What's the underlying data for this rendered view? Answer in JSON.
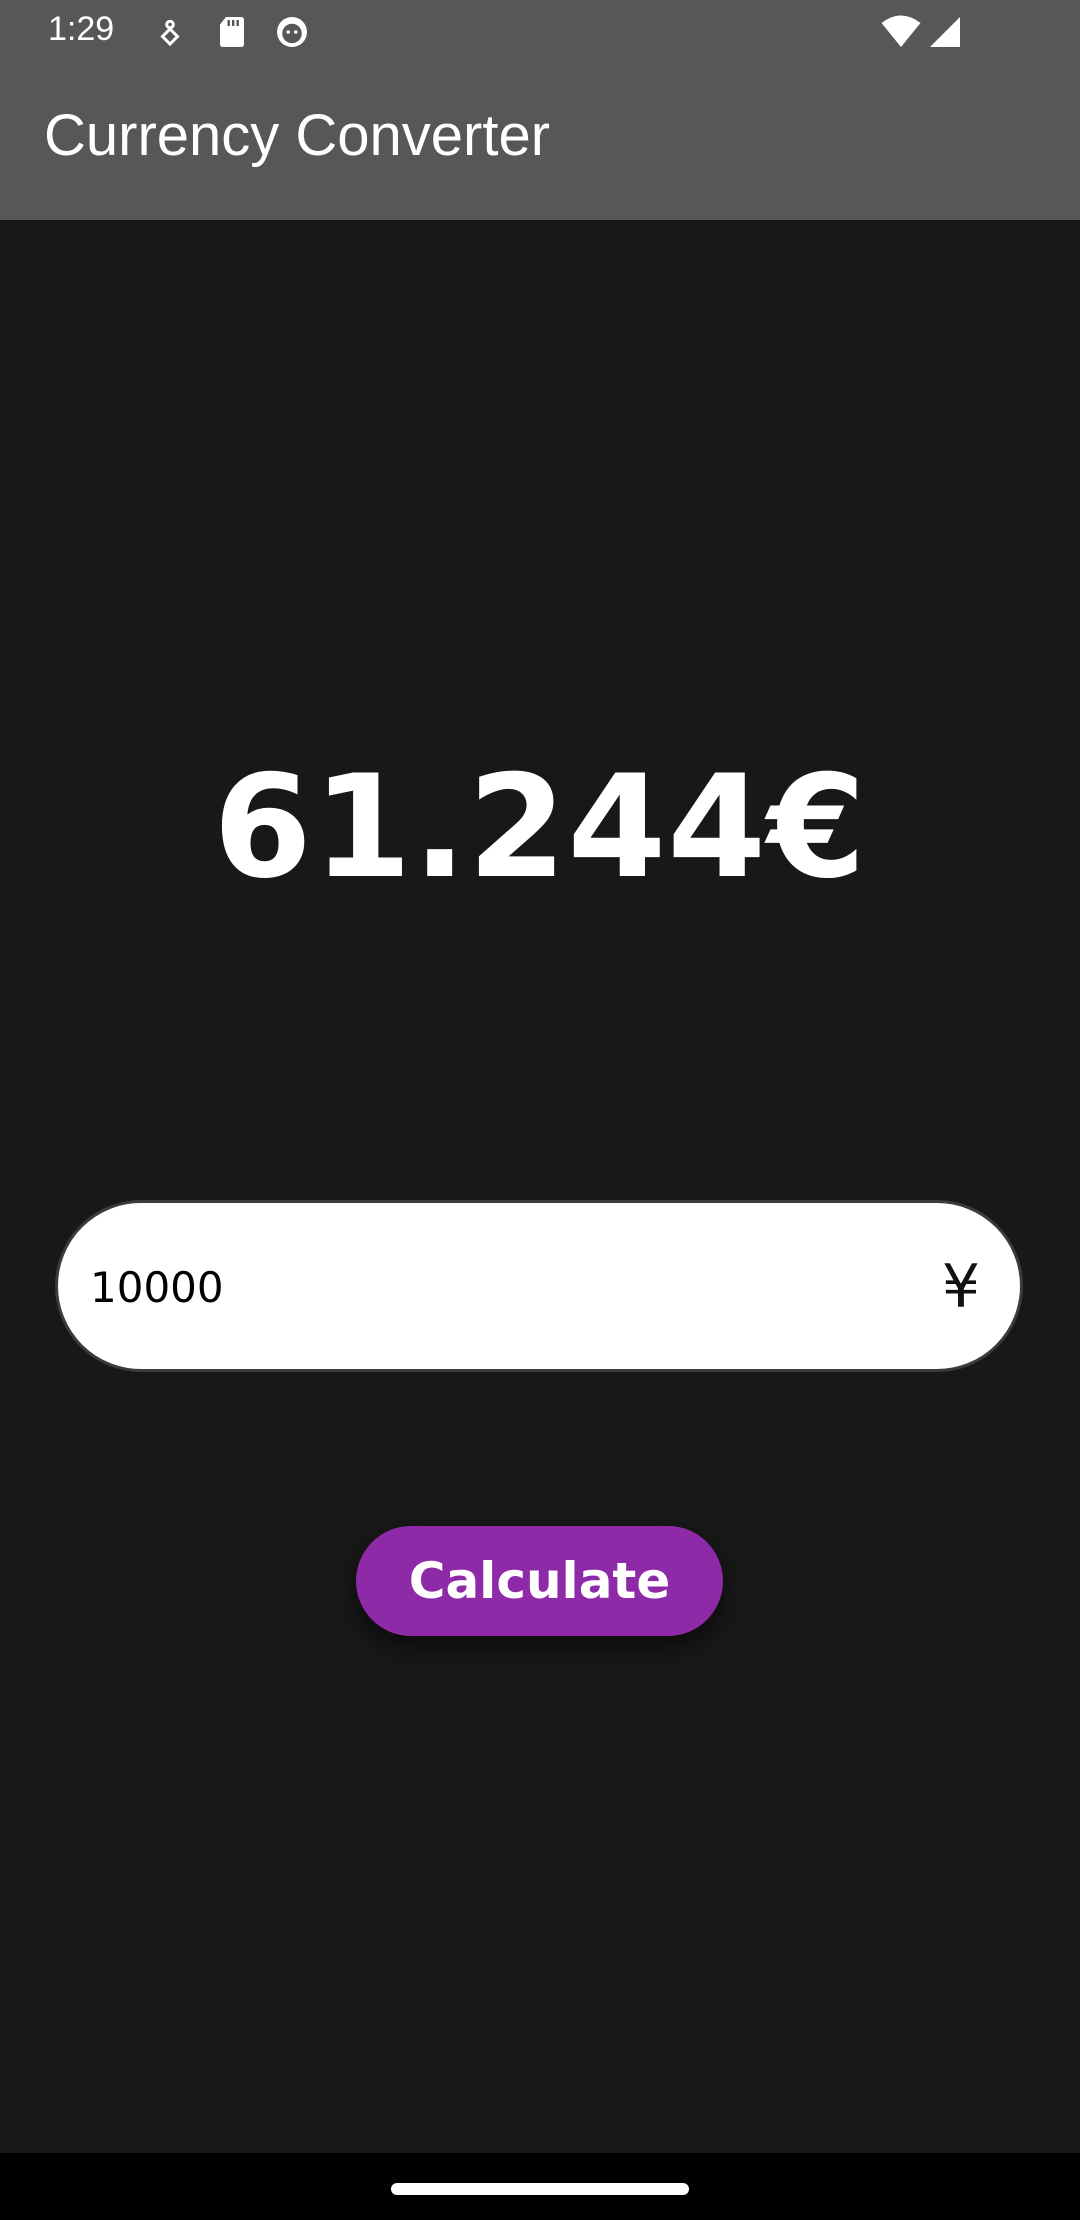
{
  "status_bar": {
    "time": "1:29",
    "icons": [
      "debug-icon",
      "sd-card-icon",
      "cat-icon",
      "wifi-icon",
      "signal-icon"
    ]
  },
  "app_bar": {
    "title": "Currency Converter"
  },
  "result": {
    "value": "61.244€"
  },
  "amount_input": {
    "value": "10000",
    "currency_symbol": "¥"
  },
  "calculate_button": {
    "label": "Calculate"
  },
  "colors": {
    "background": "#181818",
    "app_bar": "#575757",
    "accent": "#8e2aa8"
  }
}
